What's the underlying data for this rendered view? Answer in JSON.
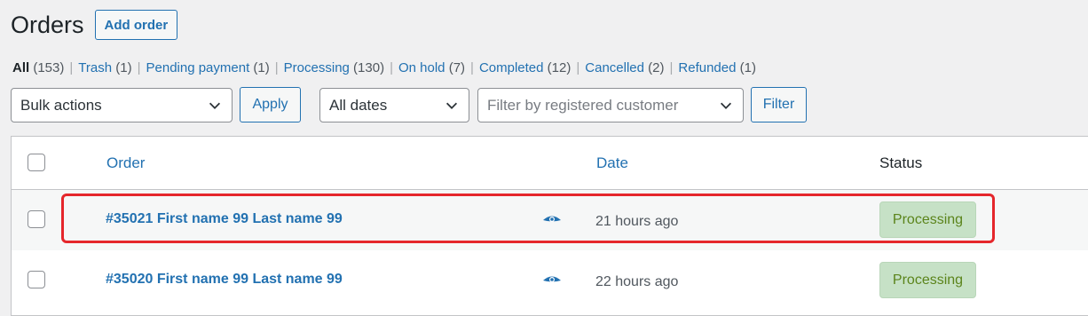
{
  "header": {
    "title": "Orders",
    "add_button": "Add order"
  },
  "views": [
    {
      "label": "All",
      "count": "(153)",
      "current": true
    },
    {
      "label": "Trash",
      "count": "(1)"
    },
    {
      "label": "Pending payment",
      "count": "(1)"
    },
    {
      "label": "Processing",
      "count": "(130)"
    },
    {
      "label": "On hold",
      "count": "(7)"
    },
    {
      "label": "Completed",
      "count": "(12)"
    },
    {
      "label": "Cancelled",
      "count": "(2)"
    },
    {
      "label": "Refunded",
      "count": "(1)"
    }
  ],
  "filters": {
    "bulk_actions": "Bulk actions",
    "apply": "Apply",
    "dates": "All dates",
    "customer_placeholder": "Filter by registered customer",
    "filter": "Filter"
  },
  "table": {
    "columns": {
      "order": "Order",
      "date": "Date",
      "status": "Status"
    },
    "rows": [
      {
        "order": "#35021 First name 99 Last name 99",
        "date": "21 hours ago",
        "status": "Processing"
      },
      {
        "order": "#35020 First name 99 Last name 99",
        "date": "22 hours ago",
        "status": "Processing"
      }
    ]
  },
  "colors": {
    "accent": "#2271b1",
    "status_bg": "#c6e1c6",
    "status_text": "#5b841b",
    "highlight": "#e5262b"
  },
  "icons": {
    "chevron": "chevron-down-icon",
    "preview": "eye-icon"
  }
}
